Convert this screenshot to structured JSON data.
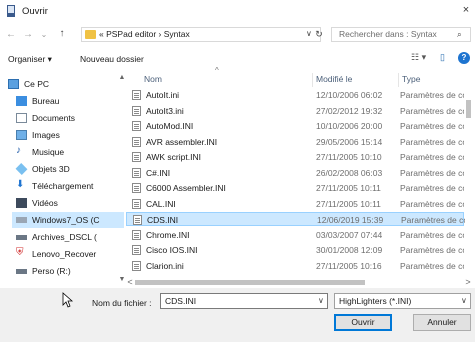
{
  "window": {
    "title": "Ouvrir",
    "close_glyph": "×"
  },
  "nav": {
    "back_glyph": "←",
    "forward_glyph": "→",
    "dropdown_glyph": "⌄",
    "up_glyph": "↑",
    "address": "« PSPad editor › Syntax",
    "address_dropdown_glyph": "∨",
    "refresh_glyph": "↻",
    "search_placeholder": "Rechercher dans : Syntax",
    "search_glyph": "⌕"
  },
  "toolbar": {
    "organize_label": "Organiser ▾",
    "new_folder_label": "Nouveau dossier",
    "view_glyph": "☷ ▾",
    "pane_glyph": "▯",
    "help_glyph": "?"
  },
  "sidebar": {
    "items": [
      {
        "label": "Ce PC",
        "icon": "computer-icon"
      },
      {
        "label": "Bureau",
        "icon": "desktop-icon"
      },
      {
        "label": "Documents",
        "icon": "documents-icon"
      },
      {
        "label": "Images",
        "icon": "images-icon"
      },
      {
        "label": "Musique",
        "icon": "music-icon"
      },
      {
        "label": "Objets 3D",
        "icon": "3d-objects-icon"
      },
      {
        "label": "Téléchargement",
        "icon": "downloads-icon"
      },
      {
        "label": "Vidéos",
        "icon": "videos-icon"
      },
      {
        "label": "Windows7_OS (C",
        "icon": "drive-icon"
      },
      {
        "label": "Archives_DSCL (",
        "icon": "drive-icon"
      },
      {
        "label": "Lenovo_Recover",
        "icon": "drive-icon"
      },
      {
        "label": "Perso (R:)",
        "icon": "drive-icon"
      }
    ],
    "scroll_up_glyph": "▲",
    "scroll_down_glyph": "▼"
  },
  "file_list": {
    "columns": [
      "Nom",
      "Modifié le",
      "Type"
    ],
    "sort_glyph": "^",
    "rows": [
      {
        "name": "AutoIt.ini",
        "modified": "12/10/2006 06:02",
        "type": "Paramètres de co"
      },
      {
        "name": "AutoIt3.ini",
        "modified": "27/02/2012 19:32",
        "type": "Paramètres de co"
      },
      {
        "name": "AutoMod.INI",
        "modified": "10/10/2006 20:00",
        "type": "Paramètres de co"
      },
      {
        "name": "AVR assembler.INI",
        "modified": "29/05/2006 15:14",
        "type": "Paramètres de co"
      },
      {
        "name": "AWK script.INI",
        "modified": "27/11/2005 10:10",
        "type": "Paramètres de co"
      },
      {
        "name": "C#.INI",
        "modified": "26/02/2008 06:03",
        "type": "Paramètres de co"
      },
      {
        "name": "C6000 Assembler.INI",
        "modified": "27/11/2005 10:11",
        "type": "Paramètres de co"
      },
      {
        "name": "CAL.INI",
        "modified": "27/11/2005 10:11",
        "type": "Paramètres de co"
      },
      {
        "name": "CDS.INI",
        "modified": "12/06/2019 15:39",
        "type": "Paramètres de co"
      },
      {
        "name": "Chrome.INI",
        "modified": "03/03/2007 07:44",
        "type": "Paramètres de co"
      },
      {
        "name": "Cisco IOS.INI",
        "modified": "30/01/2008 12:09",
        "type": "Paramètres de co"
      },
      {
        "name": "Clarion.ini",
        "modified": "27/11/2005 10:16",
        "type": "Paramètres de co"
      }
    ],
    "hscroll_left_glyph": "<",
    "hscroll_right_glyph": ">"
  },
  "footer": {
    "filename_label": "Nom du fichier :",
    "filename_value": "CDS.INI",
    "filename_dropdown_glyph": "∨",
    "filter_value": "HighLighters (*.INI)",
    "filter_dropdown_glyph": "∨",
    "open_label": "Ouvrir",
    "cancel_label": "Annuler"
  },
  "colors": {
    "selection": "#cce8ff",
    "accent": "#0078d7",
    "folder": "#f0c244"
  }
}
